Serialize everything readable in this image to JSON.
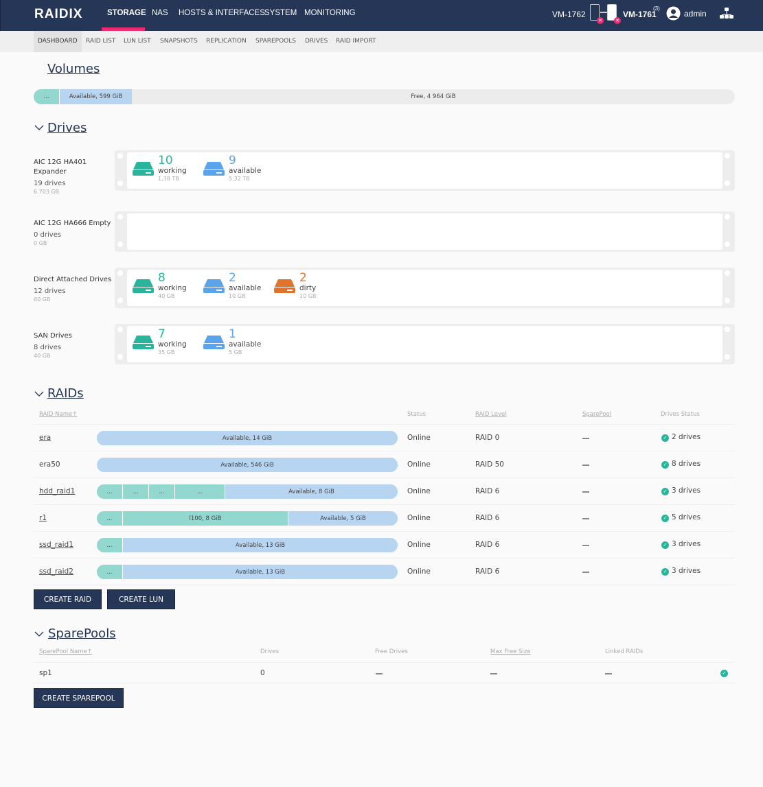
{
  "header": {
    "logo": "RAIDIX",
    "nav": [
      "STORAGE",
      "NAS",
      "HOSTS & INTERFACES",
      "SYSTEM",
      "MONITORING"
    ],
    "active_nav": "STORAGE",
    "node_left": "VM-1762",
    "node_right": "VM-1761",
    "node_right_badge": "(3)",
    "user": "admin",
    "accent_color": "#ee2a74",
    "bg_color": "#253657"
  },
  "subnav": {
    "items": [
      "DASHBOARD",
      "RAID LIST",
      "LUN LIST",
      "SNAPSHOTS",
      "REPLICATION",
      "SPAREPOOLS",
      "DRIVES",
      "RAID IMPORT"
    ],
    "active": "DASHBOARD"
  },
  "volumes": {
    "title": "Volumes",
    "segments": [
      {
        "label": "...",
        "type": "used"
      },
      {
        "label": "Available, 599 GiB",
        "type": "available"
      },
      {
        "label": "Free, 4 964 GiB",
        "type": "free"
      }
    ]
  },
  "drives": {
    "title": "Drives",
    "enclosures": [
      {
        "name": "AIC 12G HA401 Expander",
        "count": "19 drives",
        "size": "6 703 GB",
        "groups": [
          {
            "count": "10",
            "label": "working",
            "size": "1,38 TB",
            "color": "#29b59b"
          },
          {
            "count": "9",
            "label": "available",
            "size": "5,32 TB",
            "color": "#5ba4ec"
          }
        ]
      },
      {
        "name": "AIC 12G HA666 Empty",
        "count": "0 drives",
        "size": "0 GB",
        "groups": []
      },
      {
        "name": "Direct Attached Drives",
        "count": "12 drives",
        "size": "60 GB",
        "groups": [
          {
            "count": "8",
            "label": "working",
            "size": "40 GB",
            "color": "#29b59b"
          },
          {
            "count": "2",
            "label": "available",
            "size": "10 GB",
            "color": "#5ba4ec"
          },
          {
            "count": "2",
            "label": "dirty",
            "size": "10 GB",
            "color": "#e0742a"
          }
        ]
      },
      {
        "name": "SAN Drives",
        "count": "8 drives",
        "size": "40 GB",
        "groups": [
          {
            "count": "7",
            "label": "working",
            "size": "35 GB",
            "color": "#29b59b"
          },
          {
            "count": "1",
            "label": "available",
            "size": "5 GB",
            "color": "#5ba4ec"
          }
        ]
      }
    ]
  },
  "raids": {
    "title": "RAIDs",
    "columns": [
      "RAID Name↑",
      "Status",
      "RAID Level",
      "SparePool",
      "Drives Status"
    ],
    "rows": [
      {
        "name": "era",
        "link": true,
        "segments": [
          {
            "label": "Available, 14 GiB",
            "type": "available",
            "frac": 1.0
          }
        ],
        "status": "Online",
        "level": "RAID 0",
        "sparepool": "—",
        "drives": "2 drives"
      },
      {
        "name": "era50",
        "link": false,
        "segments": [
          {
            "label": "Available, 546 GiB",
            "type": "available",
            "frac": 1.0
          }
        ],
        "status": "Online",
        "level": "RAID 50",
        "sparepool": "—",
        "drives": "8 drives"
      },
      {
        "name": "hdd_raid1",
        "link": true,
        "segments": [
          {
            "label": "...",
            "type": "used",
            "frac": 0.086
          },
          {
            "label": "...",
            "type": "used",
            "frac": 0.087
          },
          {
            "label": "...",
            "type": "used",
            "frac": 0.086
          },
          {
            "label": "...",
            "type": "used",
            "frac": 0.167
          },
          {
            "label": "Available, 8 GiB",
            "type": "available",
            "frac": 0.574
          }
        ],
        "status": "Online",
        "level": "RAID 6",
        "sparepool": "—",
        "drives": "3 drives"
      },
      {
        "name": "r1",
        "link": true,
        "segments": [
          {
            "label": "...",
            "type": "used",
            "frac": 0.086
          },
          {
            "label": "l100, 8 GiB",
            "type": "used",
            "frac": 0.55
          },
          {
            "label": "Available, 5 GiB",
            "type": "available",
            "frac": 0.364
          }
        ],
        "status": "Online",
        "level": "RAID 6",
        "sparepool": "—",
        "drives": "5 drives"
      },
      {
        "name": "ssd_raid1",
        "link": true,
        "segments": [
          {
            "label": "...",
            "type": "used",
            "frac": 0.086
          },
          {
            "label": "Available, 13 GiB",
            "type": "available",
            "frac": 0.914
          }
        ],
        "status": "Online",
        "level": "RAID 6",
        "sparepool": "—",
        "drives": "3 drives"
      },
      {
        "name": "ssd_raid2",
        "link": true,
        "segments": [
          {
            "label": "...",
            "type": "used",
            "frac": 0.086
          },
          {
            "label": "Available, 13 GiB",
            "type": "available",
            "frac": 0.914
          }
        ],
        "status": "Online",
        "level": "RAID 6",
        "sparepool": "—",
        "drives": "3 drives"
      }
    ],
    "buttons": {
      "create_raid": "CREATE RAID",
      "create_lun": "CREATE LUN"
    }
  },
  "sparepools": {
    "title": "SparePools",
    "columns": [
      "SparePool Name↑",
      "Drives",
      "Free Drives",
      "Max Free Size",
      "Linked RAIDs"
    ],
    "rows": [
      {
        "name": "sp1",
        "drives": "0",
        "free_drives": "—",
        "max_free_size": "—",
        "linked_raids": "—",
        "ok": true
      }
    ],
    "buttons": {
      "create_sparepool": "CREATE SPAREPOOL"
    }
  }
}
